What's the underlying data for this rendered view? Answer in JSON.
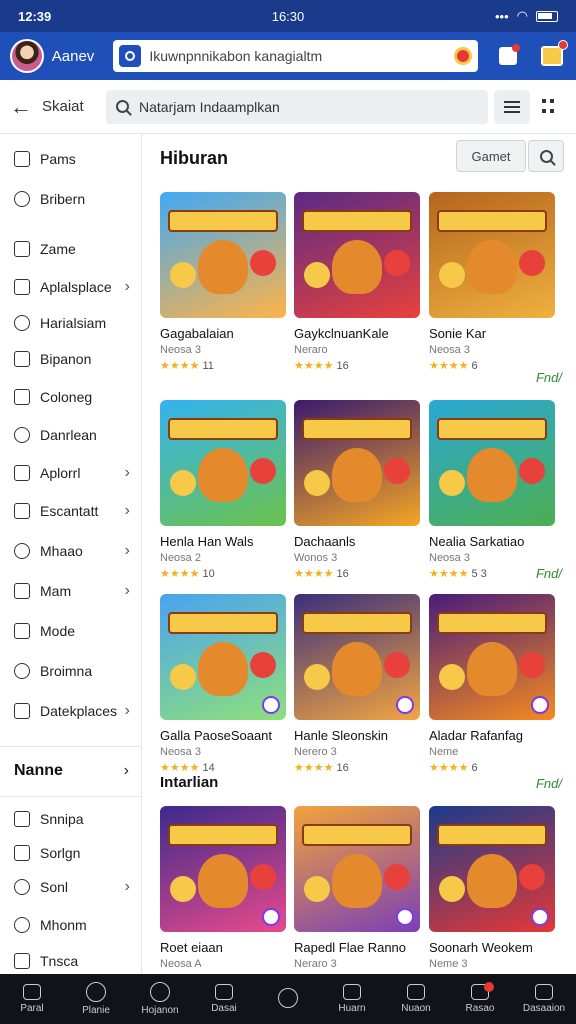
{
  "status_bar": {
    "time_left": "12:39",
    "time_center": "16:30"
  },
  "header": {
    "username": "Aanev",
    "search_value": "Ikuwnpnnikabon kanagialtm"
  },
  "toolbar": {
    "back_label": "Skaiat",
    "search_placeholder": "Natarjam Indaamplkan"
  },
  "sidebar": {
    "items": [
      {
        "label": "Pams",
        "icon": "edit-icon",
        "chevron": false
      },
      {
        "label": "Bribern",
        "icon": "share-icon",
        "chevron": false
      },
      {
        "label": "Zame",
        "icon": "bag-icon",
        "chevron": false
      },
      {
        "label": "Aplalsplace",
        "icon": "tag-icon",
        "chevron": true
      },
      {
        "label": "Harialsiam",
        "icon": "square-icon",
        "chevron": false
      },
      {
        "label": "Bipanon",
        "icon": "image-icon",
        "chevron": false
      },
      {
        "label": "Coloneg",
        "icon": "link-icon",
        "chevron": false
      },
      {
        "label": "Danrlean",
        "icon": "bell-icon",
        "chevron": false
      },
      {
        "label": "Aplorrl",
        "icon": "camera-icon",
        "chevron": true
      },
      {
        "label": "Escantatt",
        "icon": "doc-icon",
        "chevron": true
      },
      {
        "label": "Mhaao",
        "icon": "bow-icon",
        "chevron": true
      },
      {
        "label": "Mam",
        "icon": "puzzle-icon",
        "chevron": true
      },
      {
        "label": "Mode",
        "icon": "grid-icon",
        "chevron": false
      },
      {
        "label": "Broimna",
        "icon": "list-icon",
        "chevron": false
      },
      {
        "label": "Datekplaces",
        "icon": "globe-icon",
        "chevron": true
      }
    ],
    "heading": "Nanne",
    "items2": [
      {
        "label": "Snnipa",
        "icon": "mail-icon",
        "chevron": false
      },
      {
        "label": "Sorlgn",
        "icon": "chat-icon",
        "chevron": false
      },
      {
        "label": "Sonl",
        "icon": "check-circle-icon",
        "chevron": true
      },
      {
        "label": "Mhonm",
        "icon": "clock-icon",
        "chevron": false
      },
      {
        "label": "Tnsca",
        "icon": "checkbox-icon",
        "chevron": false
      }
    ]
  },
  "main": {
    "section1_title": "Hiburan",
    "game_button": "Gamet",
    "section2_title": "Intarlian",
    "more_label": "Fnd/",
    "cards": [
      {
        "title": "Gagabalaian",
        "sub": "Neosa 3",
        "rating": "11",
        "bg1": "#3fa9f5",
        "bg2": "#ffb347"
      },
      {
        "title": "GaykclnuanKale",
        "sub": "Neraro",
        "rating": "16",
        "bg1": "#5b2a86",
        "bg2": "#e8413c"
      },
      {
        "title": "Sonie Kar",
        "sub": "Neosa 3",
        "rating": "6",
        "bg1": "#b5651d",
        "bg2": "#f0b03f"
      },
      {
        "title": "Henla Han Wals",
        "sub": "Neosa 2",
        "rating": "10",
        "bg1": "#33b3f2",
        "bg2": "#6cc24a"
      },
      {
        "title": "Dachaanls",
        "sub": "Wonos 3",
        "rating": "16",
        "bg1": "#3a1a6e",
        "bg2": "#f5a623"
      },
      {
        "title": "Nealia Sarkatiao",
        "sub": "Neosa 3",
        "rating": "5 3",
        "bg1": "#2aa7d6",
        "bg2": "#4caf50"
      },
      {
        "title": "Galla PaoseSoaant",
        "sub": "Neosa 3",
        "rating": "14",
        "bg1": "#4aa3f0",
        "bg2": "#8ee07a"
      },
      {
        "title": "Hanle Sleonskin",
        "sub": "Nerero 3",
        "rating": "16",
        "bg1": "#3b2f7a",
        "bg2": "#f2a541"
      },
      {
        "title": "Aladar Rafanfag",
        "sub": "Neme",
        "rating": "6",
        "bg1": "#4a1c7a",
        "bg2": "#f58a1f"
      },
      {
        "title": "Roet eiaan",
        "sub": "Neosa A",
        "rating": "",
        "bg1": "#3c2a8c",
        "bg2": "#e84a8c"
      },
      {
        "title": "Rapedl Flae Ranno",
        "sub": "Neraro 3",
        "rating": "",
        "bg1": "#f2a33a",
        "bg2": "#7b3fb6"
      },
      {
        "title": "Soonarh Weokem",
        "sub": "Neme 3",
        "rating": "",
        "bg1": "#1a3a8c",
        "bg2": "#e53935"
      }
    ]
  },
  "bottom_nav": {
    "items": [
      "Paral",
      "Planie",
      "Hojanon",
      "Dasai",
      "",
      "Huarn",
      "Nuaon",
      "Rasao",
      "Dasaaion"
    ]
  }
}
